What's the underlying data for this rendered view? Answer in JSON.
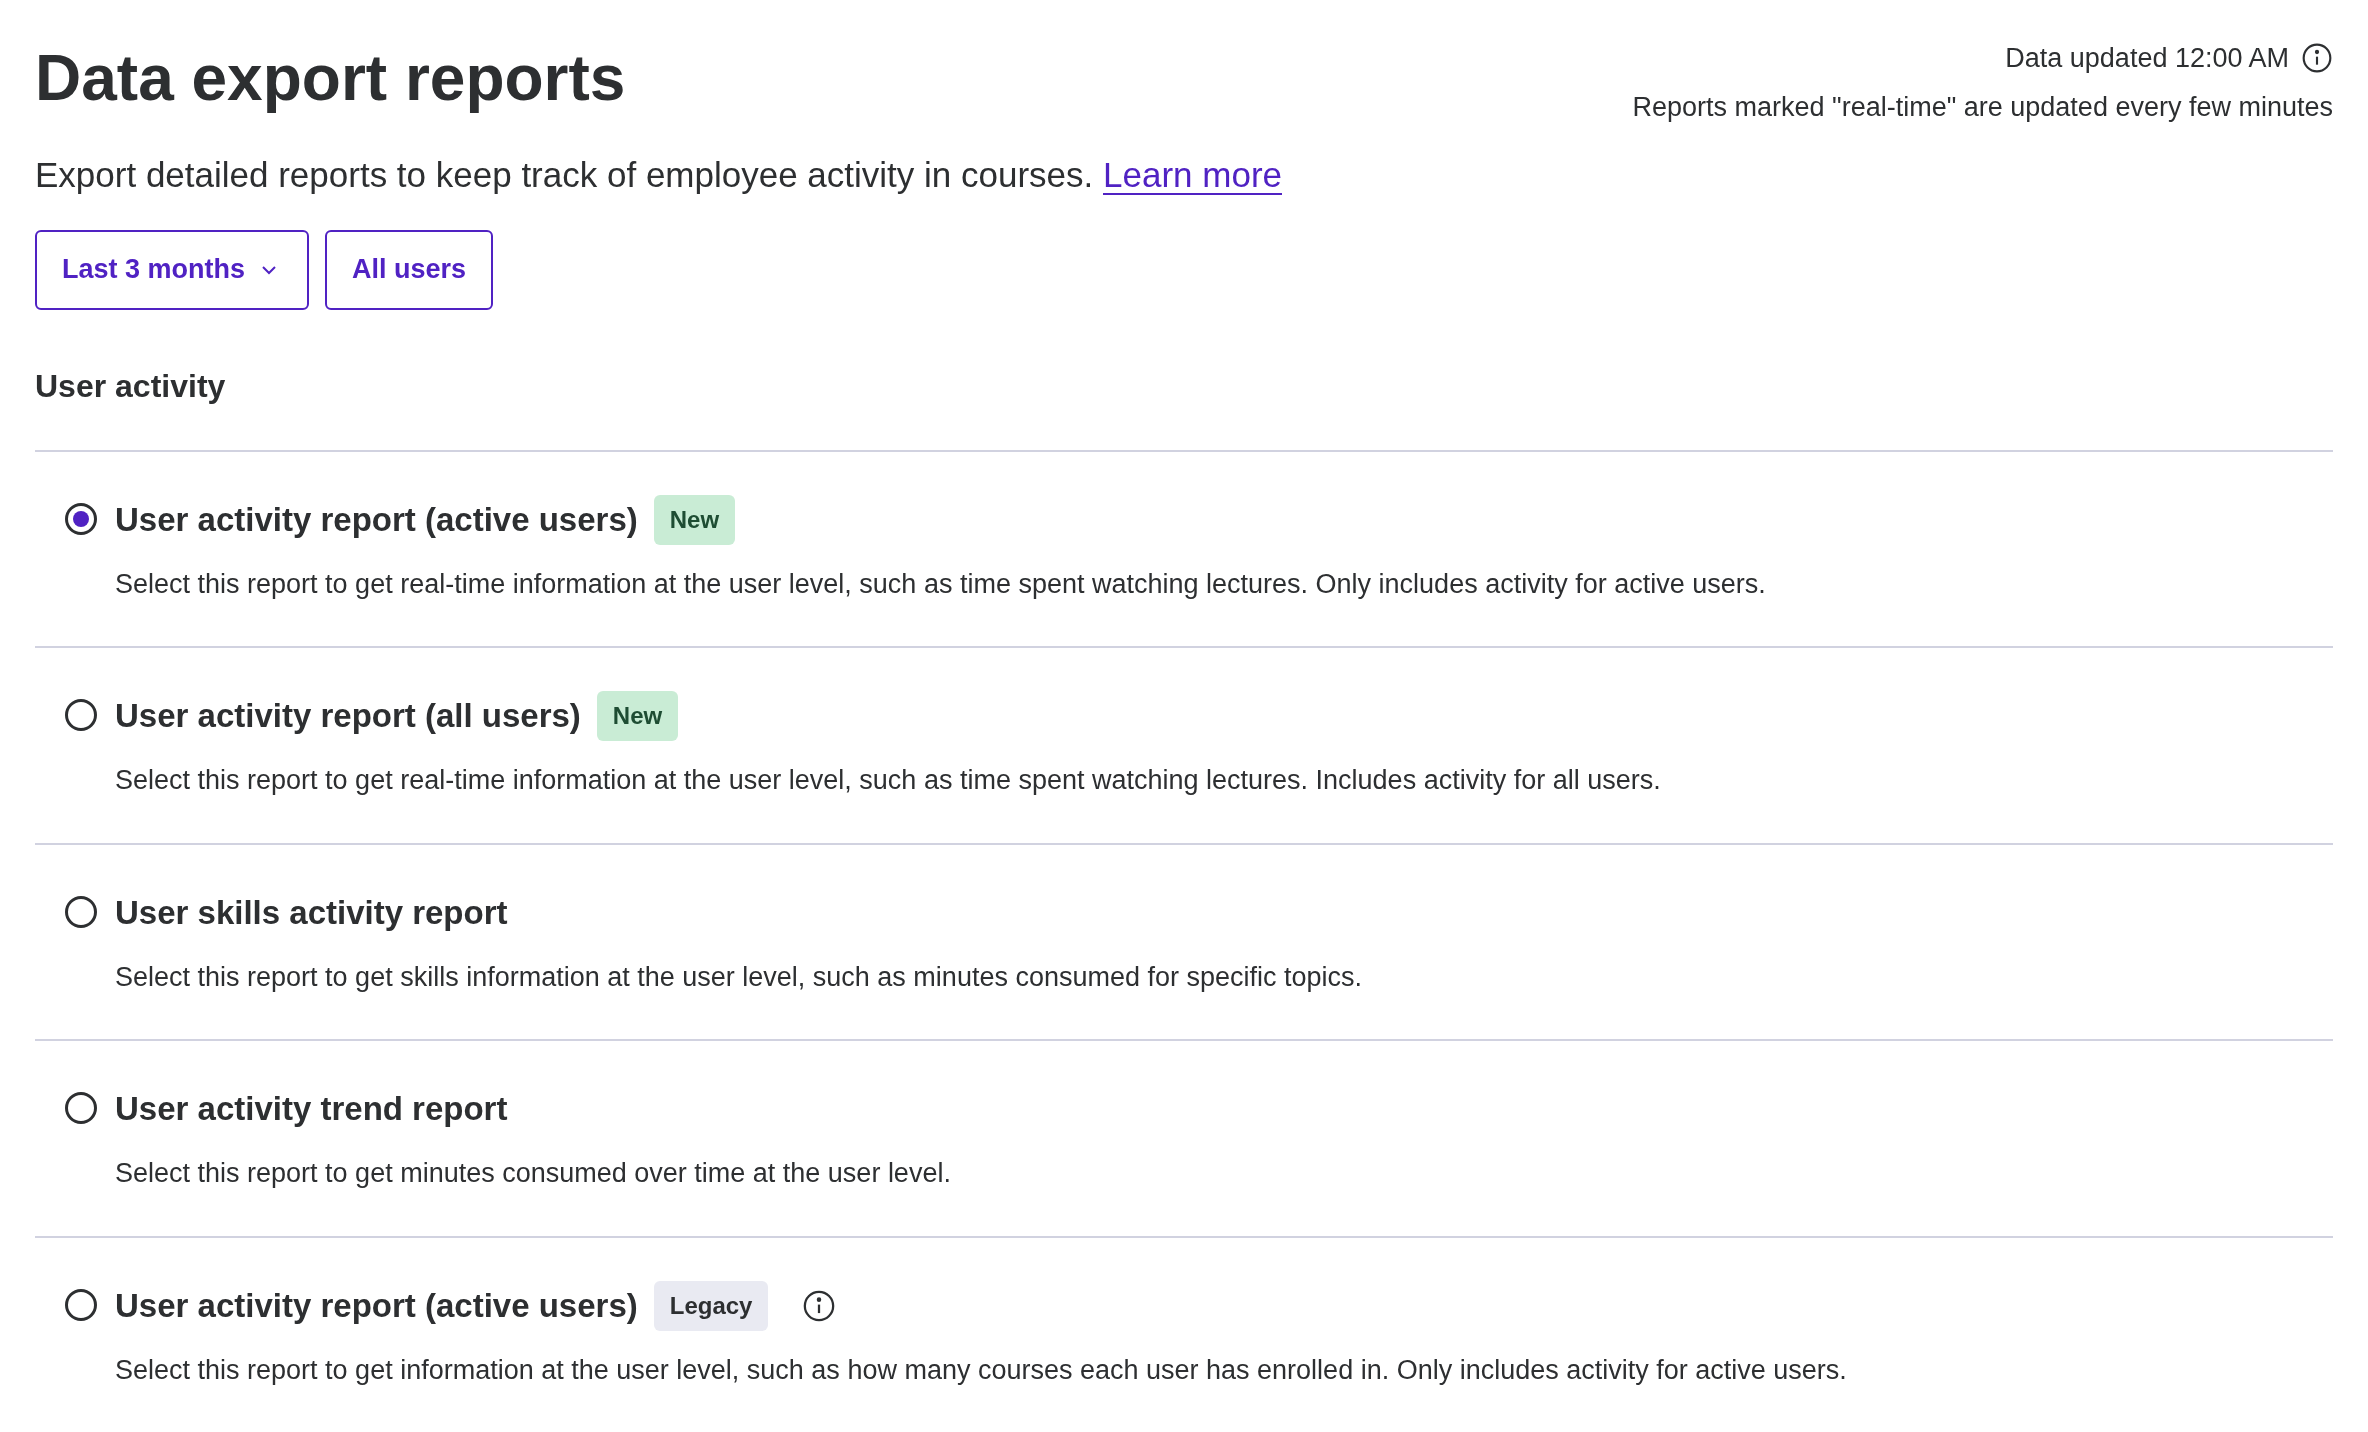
{
  "header": {
    "title": "Data export reports",
    "updated": "Data updated 12:00 AM",
    "note": "Reports marked \"real-time\" are updated every few minutes"
  },
  "intro": {
    "text": "Export detailed reports to keep track of employee activity in courses.",
    "link": "Learn more"
  },
  "filters": [
    {
      "label": "Last 3 months",
      "kind": "dropdown"
    },
    {
      "label": "All users",
      "kind": "button"
    }
  ],
  "section": {
    "title": "User activity"
  },
  "reports": [
    {
      "title": "User activity report (active users)",
      "badge": {
        "label": "New",
        "kind": "new"
      },
      "info": false,
      "selected": true,
      "description": "Select this report to get real-time information at the user level, such as time spent watching lectures. Only includes activity for active users."
    },
    {
      "title": "User activity report (all users)",
      "badge": {
        "label": "New",
        "kind": "new"
      },
      "info": false,
      "selected": false,
      "description": "Select this report to get real-time information at the user level, such as time spent watching lectures. Includes activity for all users."
    },
    {
      "title": "User skills activity report",
      "info": false,
      "selected": false,
      "description": "Select this report to get skills information at the user level, such as minutes consumed for specific topics."
    },
    {
      "title": "User activity trend report",
      "info": false,
      "selected": false,
      "description": "Select this report to get minutes consumed over time at the user level."
    },
    {
      "title": "User activity report (active users)",
      "badge": {
        "label": "Legacy",
        "kind": "legacy"
      },
      "info": true,
      "selected": false,
      "description": "Select this report to get information at the user level, such as how many courses each user has enrolled in. Only includes activity for active users."
    }
  ]
}
